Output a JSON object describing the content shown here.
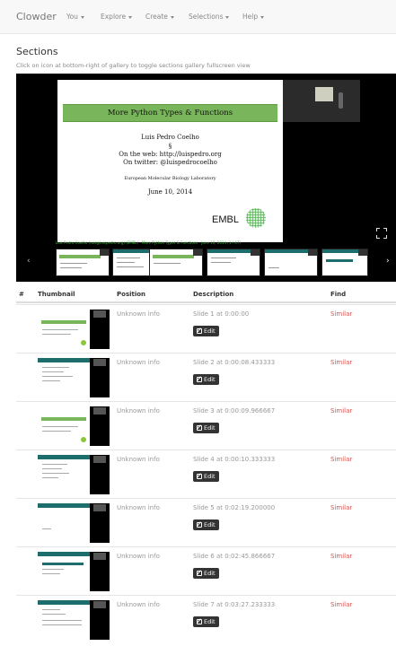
{
  "navbar": {
    "brand": "Clowder",
    "items": [
      {
        "label": "You",
        "dropdown": true
      },
      {
        "label": "Explore",
        "dropdown": true
      },
      {
        "label": "Create",
        "dropdown": true
      },
      {
        "label": "Selections",
        "dropdown": true
      },
      {
        "label": "Help",
        "dropdown": true
      }
    ]
  },
  "page": {
    "title": "Sections",
    "subtitle": "Click on icon at bottom-right of gallery to toggle sections gallery fullscreen view"
  },
  "gallery": {
    "slide": {
      "title": "More Python Types & Functions",
      "author": "Luis Pedro Coelho",
      "symbol": "§",
      "web": "On the web: http://luispedro.org",
      "twitter": "On twitter: @luispedrocoelho",
      "org": "European Molecular Biology Laboratory",
      "date": "June 10, 2014",
      "logo_text": "EMBL"
    },
    "ticker": "Luis Pedro Coelho (luis@luispedro.org) (EMBL) · More Python Types & Functions · June 10, 2014 (1 / 47)",
    "prev_icon": "chevron-left-icon",
    "next_icon": "chevron-right-icon",
    "fullscreen_icon": "expand-icon"
  },
  "table": {
    "columns": [
      "#",
      "Thumbnail",
      "Position",
      "Description",
      "Find"
    ],
    "edit_label": "Edit",
    "rows": [
      {
        "position": "Unknown info",
        "description": "Slide 1 at 0:00:00",
        "find": "Similar"
      },
      {
        "position": "Unknown info",
        "description": "Slide 2 at 0:00:08.433333",
        "find": "Similar"
      },
      {
        "position": "Unknown info",
        "description": "Slide 3 at 0:00:09.966667",
        "find": "Similar"
      },
      {
        "position": "Unknown info",
        "description": "Slide 4 at 0:00:10.333333",
        "find": "Similar"
      },
      {
        "position": "Unknown info",
        "description": "Slide 5 at 0:02:19.200000",
        "find": "Similar"
      },
      {
        "position": "Unknown info",
        "description": "Slide 6 at 0:02:45.866667",
        "find": "Similar"
      },
      {
        "position": "Unknown info",
        "description": "Slide 7 at 0:03:27.233333",
        "find": "Similar"
      }
    ]
  },
  "colors": {
    "accent_green": "#79b55a",
    "link_red": "#d9534f",
    "teal": "#1e6d6d"
  }
}
